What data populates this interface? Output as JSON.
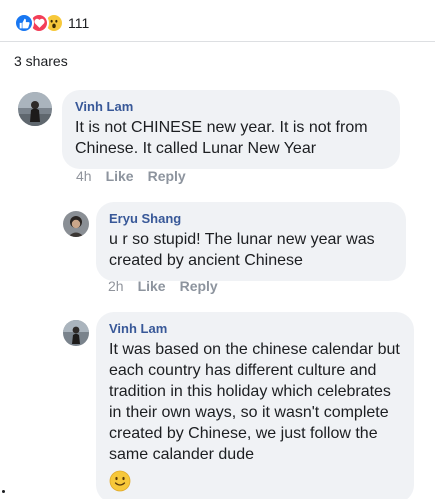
{
  "reactions": {
    "icons": [
      "like-icon",
      "love-icon",
      "wow-icon"
    ],
    "count": "111"
  },
  "shares": "3 shares",
  "comments": [
    {
      "author": "Vinh Lam",
      "text": "It is not CHINESE new year. It is not from Chinese. It called Lunar New Year",
      "time": "4h",
      "like": "Like",
      "reply": "Reply"
    },
    {
      "author": "Eryu Shang",
      "text": "u r so stupid! The lunar new year was created by ancient Chinese",
      "time": "2h",
      "like": "Like",
      "reply": "Reply"
    },
    {
      "author": "Vinh Lam",
      "text": "It was based on the chinese calendar but each country has different culture and tradition in this holiday which celebrates in their own ways, so it wasn't complete created by Chinese, we just follow the same calander dude",
      "emoji": "slightly-smiling-face-icon"
    }
  ],
  "colors": {
    "link": "#385898",
    "bubble": "#f0f2f5",
    "meta": "#90949c",
    "like": "#1877f2",
    "love": "#f33e58",
    "wow": "#f7c83a"
  }
}
